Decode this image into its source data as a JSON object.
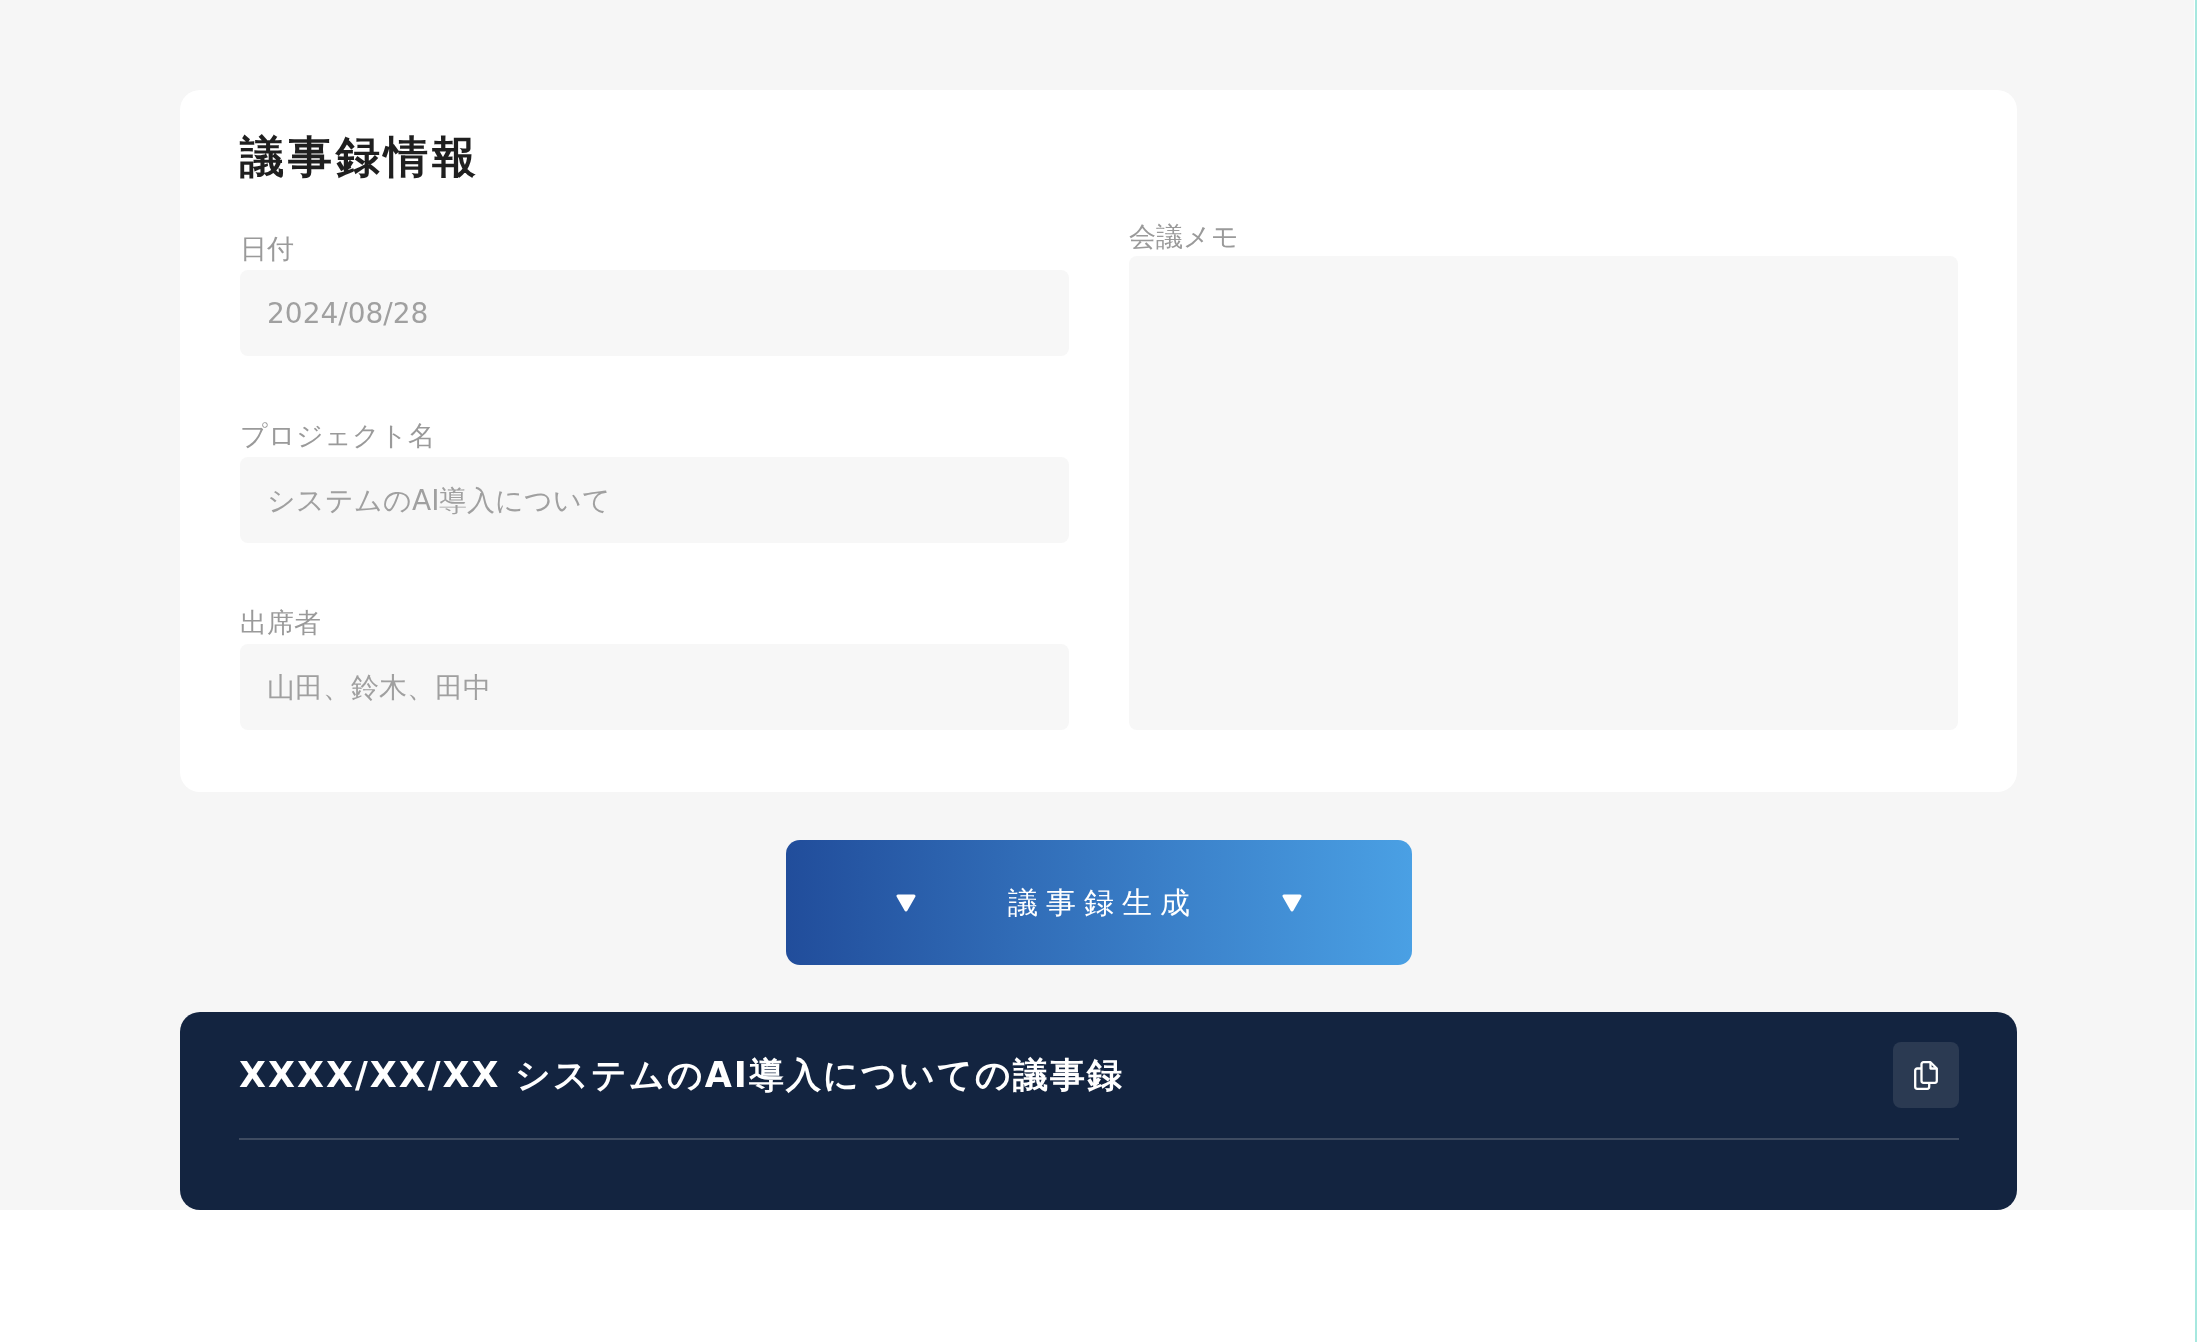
{
  "form": {
    "title": "議事録情報",
    "fields": [
      {
        "label": "日付",
        "placeholder": "2024/08/28"
      },
      {
        "label": "プロジェクト名",
        "placeholder": "システムのAI導入について"
      },
      {
        "label": "出席者",
        "placeholder": "山田、鈴木、田中"
      }
    ],
    "memo": {
      "label": "会議メモ"
    }
  },
  "generate_button": {
    "label": "議事録生成"
  },
  "result": {
    "title": "XXXX/XX/XX システムのAI導入についての議事録"
  }
}
